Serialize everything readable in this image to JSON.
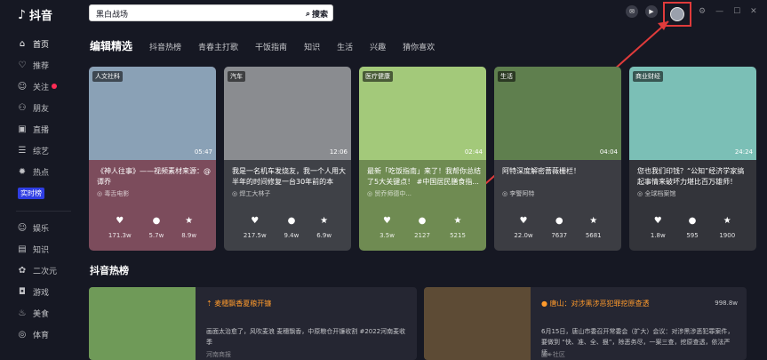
{
  "app": {
    "name": "抖音",
    "logo_glyph": "♪"
  },
  "sidebar": {
    "primary": [
      {
        "label": "首页",
        "icon": "⌂",
        "active": true
      },
      {
        "label": "推荐",
        "icon": "♡"
      },
      {
        "label": "关注",
        "icon": "☺",
        "badge": true
      },
      {
        "label": "朋友",
        "icon": "⚇"
      },
      {
        "label": "直播",
        "icon": "▣"
      },
      {
        "label": "综艺",
        "icon": "☰"
      },
      {
        "label": "热点",
        "icon": "✹"
      }
    ],
    "tag": "实时榜",
    "secondary": [
      {
        "label": "娱乐",
        "icon": "☺"
      },
      {
        "label": "知识",
        "icon": "▤"
      },
      {
        "label": "二次元",
        "icon": "✿"
      },
      {
        "label": "游戏",
        "icon": "◘"
      },
      {
        "label": "美食",
        "icon": "♨"
      },
      {
        "label": "体育",
        "icon": "◎"
      }
    ]
  },
  "search": {
    "value": "黑白战场",
    "button": "搜索",
    "icon": "⌕"
  },
  "top_icons": [
    {
      "name": "message-icon",
      "glyph": "✉"
    },
    {
      "name": "video-icon",
      "glyph": "▶"
    }
  ],
  "window_controls": [
    "⚙",
    "—",
    "☐",
    "✕"
  ],
  "tabs": [
    "编辑精选",
    "抖音热榜",
    "青春主打歌",
    "干饭指南",
    "知识",
    "生活",
    "兴趣",
    "猜你喜欢"
  ],
  "cards": [
    {
      "tag": "人文社科",
      "duration": "05:47",
      "title": "《神人往事》——视频素材来源：@谭乔",
      "author": "毒舌电影",
      "likes": "171.3w",
      "comments": "5.7w",
      "favorites": "8.9w",
      "bg": "#7c4c5c",
      "thumb": "#8aa1b6"
    },
    {
      "tag": "汽车",
      "duration": "12:06",
      "title": "我是一名机车发烧友，我一个人用大半年的时间修复一台30年前的本田...",
      "author": "焊工大林子",
      "likes": "217.5w",
      "comments": "9.4w",
      "favorites": "6.9w",
      "bg": "#3f4147",
      "thumb": "#8a8c90"
    },
    {
      "tag": "医疗健康",
      "duration": "02:44",
      "title": "最新「吃饭指南」来了！我帮你总结了5大关键点！ #中国居民膳食指...",
      "author": "贸乔师德中...",
      "likes": "3.5w",
      "comments": "2127",
      "favorites": "5215",
      "bg": "#6f8b52",
      "thumb": "#a3c97a"
    },
    {
      "tag": "生活",
      "duration": "04:04",
      "title": "阿特深度解密蔷薇栅栏！",
      "author": "李警阿特",
      "likes": "22.0w",
      "comments": "7637",
      "favorites": "5681",
      "bg": "#3c3d43",
      "thumb": "#5f7f4e"
    },
    {
      "tag": "商业财经",
      "duration": "24:24",
      "title": "您也我们印钱？“公知”经济学家搞起事情来破坏力堪比百万雄师！ #...",
      "author": "全球档案馆",
      "likes": "1.8w",
      "comments": "595",
      "favorites": "1900",
      "bg": "#33343a",
      "thumb": "#7bbfb6"
    }
  ],
  "hot_title": "抖音热榜",
  "hot": [
    {
      "title": "麦穗飘香夏粮开镰",
      "value": "",
      "desc": "画面太治愈了，风吹麦浪 麦穗飘香，中原粮仓开镰收割 #2022河南麦收季",
      "author": "河南商报",
      "glyph": "⇡"
    },
    {
      "title": "唐山：对涉黑涉恶犯罪挖原查透",
      "value": "998.8w",
      "desc": "6月15日，唐山市委召开常委会（扩大）会议：对涉黑涉恶犯罪案件，要做到 “快、准、全、狠”，除恶务尽，一案三查，挖原查透，依法严惩。",
      "author": "国+社区",
      "glyph": "●"
    }
  ],
  "colors": {
    "accent": "#fe2c55",
    "highlight_box": "#e03b3b",
    "bg": "#161823"
  }
}
